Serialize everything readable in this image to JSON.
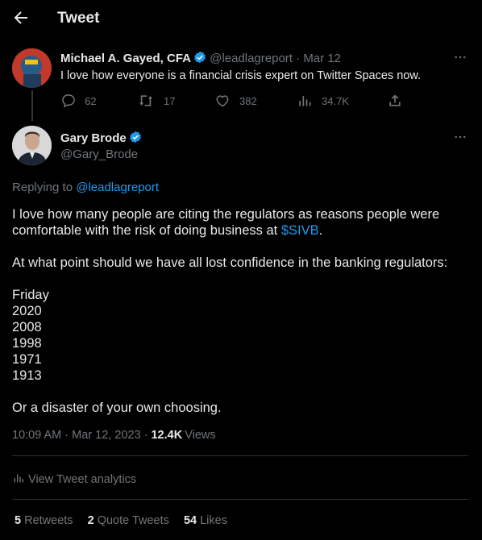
{
  "header": {
    "title": "Tweet"
  },
  "parent": {
    "name": "Michael A. Gayed, CFA",
    "handle": "@leadlagreport",
    "date": "Mar 12",
    "text": "I love how everyone is a financial crisis expert on Twitter Spaces now.",
    "replies": "62",
    "retweets": "17",
    "likes": "382",
    "views": "34.7K"
  },
  "tweet": {
    "name": "Gary Brode",
    "handle": "@Gary_Brode",
    "replying_label": "Replying to",
    "replying_to": "@leadlagreport",
    "line1": "I love how many people are citing the regulators as reasons people were",
    "line2_pre": "comfortable with the risk of doing business at",
    "cashtag": "$SIVB",
    "line2_post": ".",
    "question": "At what point should we have all lost confidence in the banking regulators:",
    "years": [
      "Friday",
      "2020",
      "2008",
      "1998",
      "1971",
      "1913"
    ],
    "closing": "Or a disaster of your own choosing.",
    "timestamp": "10:09 AM · Mar 12, 2023 ·",
    "views_count": "12.4K",
    "views_label": "Views",
    "analytics_label": "View Tweet analytics",
    "retweets_count": "5",
    "retweets_label": "Retweets",
    "quotes_count": "2",
    "quotes_label": "Quote Tweets",
    "likes_count": "54",
    "likes_label": "Likes"
  },
  "colors": {
    "accent": "#1d9bf0",
    "muted": "#71767b",
    "background": "#000000"
  }
}
